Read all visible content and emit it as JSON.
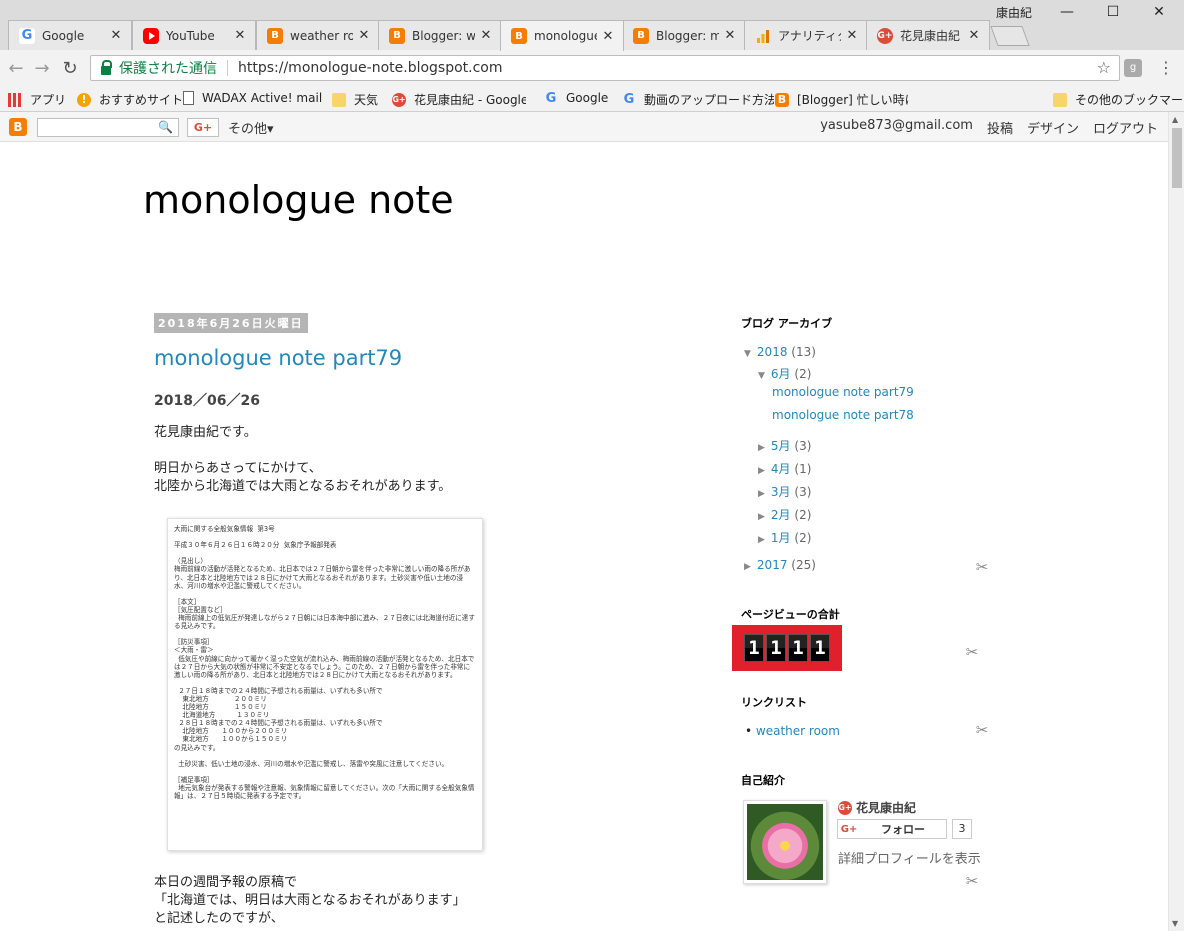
{
  "browser": {
    "profile_name": "康由紀",
    "tabs": [
      {
        "title": "Google",
        "icon": "google-icon"
      },
      {
        "title": "YouTube",
        "icon": "youtube-icon"
      },
      {
        "title": "weather room",
        "icon": "blogger-icon"
      },
      {
        "title": "Blogger: weather",
        "icon": "blogger-icon"
      },
      {
        "title": "monologue note",
        "icon": "blogger-icon",
        "active": true
      },
      {
        "title": "Blogger: monologue",
        "icon": "blogger-icon"
      },
      {
        "title": "アナリティクス",
        "icon": "analytics-icon"
      },
      {
        "title": "花見康由紀",
        "icon": "google-plus-icon"
      }
    ],
    "secure_label": "保護された通信",
    "url": "https://monologue-note.blogspot.com",
    "bookmarks": [
      {
        "label": "アプリ",
        "icon": "apps-icon"
      },
      {
        "label": "おすすめサイト",
        "icon": "bulb-icon"
      },
      {
        "label": "WADAX Active! mail",
        "icon": "page-icon"
      },
      {
        "label": "天気",
        "icon": "folder-icon"
      },
      {
        "label": "花見康由紀 - Google",
        "icon": "google-plus-icon"
      },
      {
        "label": "Google",
        "icon": "google-icon"
      },
      {
        "label": "動画のアップロード方法",
        "icon": "google-icon"
      },
      {
        "label": "[Blogger] 忙しい時に",
        "icon": "blogger-icon"
      },
      {
        "label": "その他のブックマーク",
        "icon": "folder-icon"
      }
    ]
  },
  "navbar": {
    "more_label": "その他",
    "gplus_label": "G+",
    "email": "yasube873@gmail.com",
    "post_label": "投稿",
    "design_label": "デザイン",
    "logout_label": "ログアウト"
  },
  "blog": {
    "title": "monologue note",
    "date_header": "2018年6月26日火曜日",
    "post_title": "monologue note part79",
    "post_date": "2018／06／26",
    "intro": "花見康由紀です。",
    "para1_line1": "明日からあさってにかけて、",
    "para1_line2": "北陸から北海道では大雨となるおそれがあります。",
    "doc_text": "大雨に関する全般気象情報  第3号\n\n平成３０年６月２６日１６時２０分  気象庁予報部発表\n\n（見出し）\n梅雨前線の活動が活発となるため、北日本では２７日朝から雷を伴った非常に激しい雨の降る所があり、北日本と北陸地方では２８日にかけて大雨となるおそれがあります。土砂災害や低い土地の浸水、河川の増水や氾濫に警戒してください。\n\n［本文］\n［気圧配置など］\n  梅雨前線上の低気圧が発達しながら２７日朝には日本海中部に進み、２７日夜には北海道付近に達する見込みです。\n\n［防災事項］\n＜大雨・雷＞\n  低気圧や前線に向かって暖かく湿った空気が流れ込み、梅雨前線の活動が活発となるため、北日本では２７日から大気の状態が非常に不安定となるでしょう。このため、２７日朝から雷を伴った非常に激しい雨の降る所があり、北日本と北陸地方では２８日にかけて大雨となるおそれがあります。\n\n  ２７日１８時までの２４時間に予想される雨量は、いずれも多い所で\n    東北地方            ２００ミリ\n    北陸地方            １５０ミリ\n    北海道地方          １３０ミリ\n  ２８日１８時までの２４時間に予想される雨量は、いずれも多い所で\n    北陸地方      １００から２００ミリ\n    東北地方      １００から１５０ミリ\nの見込みです。\n\n  土砂災害、低い土地の浸水、河川の増水や氾濫に警戒し、落雷や突風に注意してください。\n\n［補足事項］\n  地元気象台が発表する警報や注意報、気象情報に留意してください。次の「大雨に関する全般気象情報」は、２７日５時頃に発表する予定です。",
    "para2_line1": "本日の週間予報の原稿で",
    "para2_line2": "「北海道では、明日は大雨となるおそれがあります」",
    "para2_line3": "と記述したのですが、"
  },
  "sidebar": {
    "archive_heading": "ブログ アーカイブ",
    "archive": {
      "y2018": {
        "label": "2018",
        "count": "(13)"
      },
      "june": {
        "label": "6月",
        "count": "(2)"
      },
      "posts": [
        "monologue note part79",
        "monologue note part78"
      ],
      "may": {
        "label": "5月",
        "count": "(3)"
      },
      "april": {
        "label": "4月",
        "count": "(1)"
      },
      "march": {
        "label": "3月",
        "count": "(3)"
      },
      "feb": {
        "label": "2月",
        "count": "(2)"
      },
      "jan": {
        "label": "1月",
        "count": "(2)"
      },
      "y2017": {
        "label": "2017",
        "count": "(25)"
      }
    },
    "pageview_heading": "ページビューの合計",
    "pageview_digits": [
      "1",
      "1",
      "1",
      "1"
    ],
    "links_heading": "リンクリスト",
    "links": [
      "weather room"
    ],
    "profile_heading": "自己紹介",
    "profile_name": "花見康由紀",
    "follow_label": "フォロー",
    "follow_count": "3",
    "profile_link": "詳細プロフィールを表示"
  }
}
